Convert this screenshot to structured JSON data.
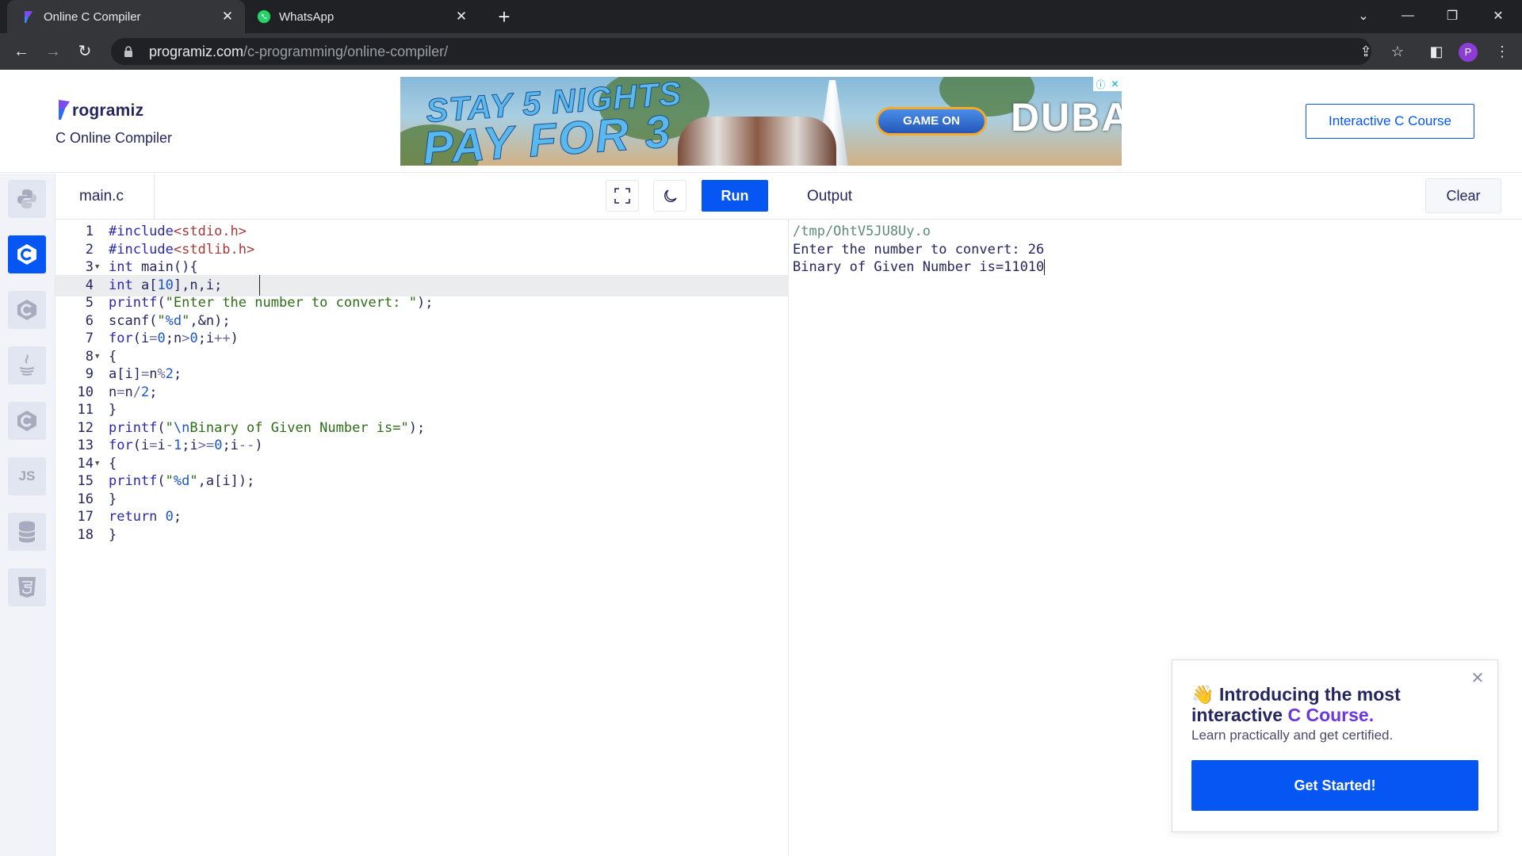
{
  "browser": {
    "tabs": [
      {
        "title": "Online C Compiler",
        "active": true,
        "favicon": "programiz-favicon"
      },
      {
        "title": "WhatsApp",
        "active": false,
        "favicon": "whatsapp-favicon"
      }
    ],
    "url_domain": "programiz.com",
    "url_path": "/c-programming/online-compiler/",
    "profile_initial": "P"
  },
  "header": {
    "logo_text": "rogramiz",
    "subtitle": "C Online Compiler",
    "course_button": "Interactive C Course"
  },
  "ad": {
    "line1": "STAY 5 NIGHTS",
    "line2": "PAY FOR 3",
    "button": "GAME ON",
    "brand": "DUBAI"
  },
  "sidebar": {
    "items": [
      {
        "name": "python",
        "label": ""
      },
      {
        "name": "c",
        "label": "",
        "active": true
      },
      {
        "name": "cpp",
        "label": ""
      },
      {
        "name": "java",
        "label": ""
      },
      {
        "name": "csharp",
        "label": ""
      },
      {
        "name": "javascript",
        "label": "JS"
      },
      {
        "name": "sql",
        "label": ""
      },
      {
        "name": "html",
        "label": ""
      }
    ]
  },
  "editor": {
    "filename": "main.c",
    "run_label": "Run",
    "highlighted_line": 4,
    "lines": [
      "#include<stdio.h>",
      "#include<stdlib.h>",
      "int main(){",
      "int a[10],n,i;",
      "printf(\"Enter the number to convert: \");",
      "scanf(\"%d\",&n);",
      "for(i=0;n>0;i++)",
      "{",
      "a[i]=n%2;",
      "n=n/2;",
      "}",
      "printf(\"\\nBinary of Given Number is=\");",
      "for(i=i-1;i>=0;i--)",
      "{",
      "printf(\"%d\",a[i]);",
      "}",
      "return 0;",
      "}"
    ]
  },
  "output": {
    "title": "Output",
    "clear_label": "Clear",
    "lines": [
      "/tmp/OhtV5JU8Uy.o",
      "Enter the number to convert: 26",
      "Binary of Given Number is=11010"
    ]
  },
  "popup": {
    "emoji": "👋",
    "title_part1": "Introducing the most interactive ",
    "title_accent": "C Course.",
    "subtitle": "Learn practically and get certified.",
    "button": "Get Started!"
  },
  "colors": {
    "accent": "#0556f3",
    "text": "#25265e",
    "purple": "#6c35de"
  }
}
